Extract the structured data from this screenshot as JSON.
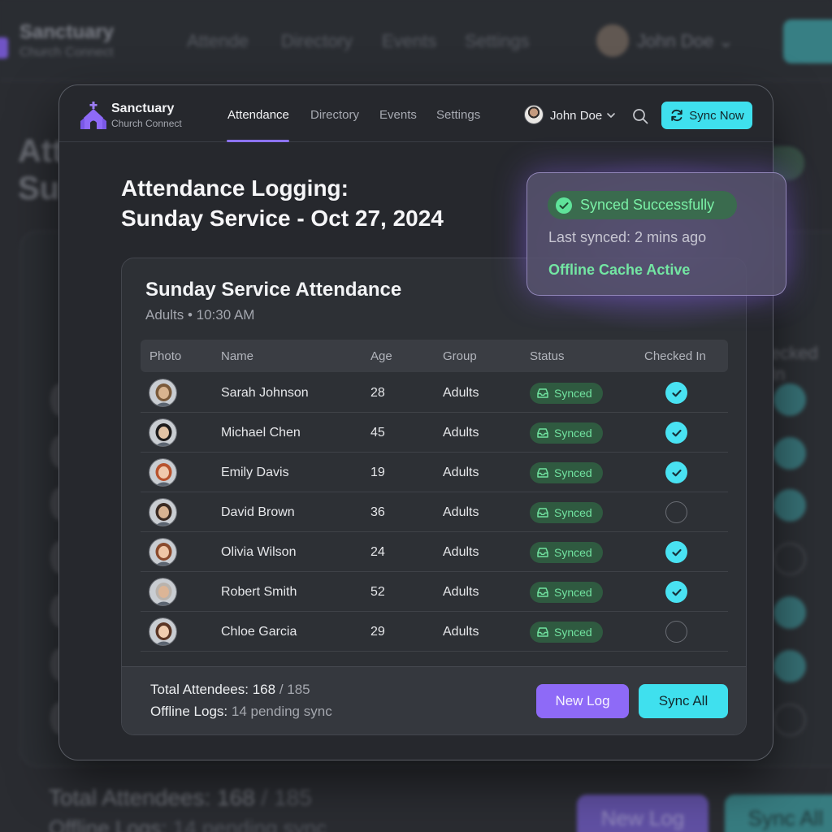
{
  "app": {
    "brand": "Sanctuary",
    "brand_sub": "Church Connect",
    "nav": [
      "Attendance",
      "Directory",
      "Events",
      "Settings"
    ],
    "active_nav": "Attendance",
    "user": "John Doe",
    "sync_now_label": "Sync Now"
  },
  "background": {
    "nav": [
      "Attende",
      "Directory",
      "Events",
      "Settings"
    ],
    "heading_line1": "Att",
    "heading_line2": "Su",
    "checked_in_header": "ecked In",
    "total_label": "Total Attendees:",
    "total_value": "168",
    "total_of": "/ 185",
    "offline_label": "Offline Logs:",
    "offline_value": "14 pending sync",
    "new_log": "New Log",
    "sync_all": "Sync All"
  },
  "page": {
    "title_line1": "Attendance Logging:",
    "title_line2": "Sunday Service - Oct 27, 2024"
  },
  "card": {
    "title": "Sunday Service Attendance",
    "subtitle": "Adults • 10:30 AM",
    "columns": [
      "Photo",
      "Name",
      "Age",
      "Group",
      "Status",
      "Checked In"
    ],
    "rows": [
      {
        "name": "Sarah Johnson",
        "age": "28",
        "group": "Adults",
        "status": "Synced",
        "checked_in": true
      },
      {
        "name": "Michael Chen",
        "age": "45",
        "group": "Adults",
        "status": "Synced",
        "checked_in": true
      },
      {
        "name": "Emily Davis",
        "age": "19",
        "group": "Adults",
        "status": "Synced",
        "checked_in": true
      },
      {
        "name": "David Brown",
        "age": "36",
        "group": "Adults",
        "status": "Synced",
        "checked_in": false
      },
      {
        "name": "Olivia Wilson",
        "age": "24",
        "group": "Adults",
        "status": "Synced",
        "checked_in": true
      },
      {
        "name": "Robert Smith",
        "age": "52",
        "group": "Adults",
        "status": "Synced",
        "checked_in": true
      },
      {
        "name": "Chloe Garcia",
        "age": "29",
        "group": "Adults",
        "status": "Synced",
        "checked_in": false
      }
    ],
    "footer": {
      "total_label": "Total Attendees:",
      "total_value": "168",
      "total_of": "/ 185",
      "offline_label": "Offline Logs:",
      "offline_value": "14 pending sync",
      "new_log": "New Log",
      "sync_all": "Sync All"
    }
  },
  "toast": {
    "status": "Synced Successfully",
    "last_synced": "Last synced: 2 mins ago",
    "cache": "Offline Cache Active"
  },
  "colors": {
    "accent_purple": "#8e6af7",
    "accent_cyan": "#3fe0ee",
    "synced_green": "#71e3a0",
    "background": "#26282d"
  }
}
